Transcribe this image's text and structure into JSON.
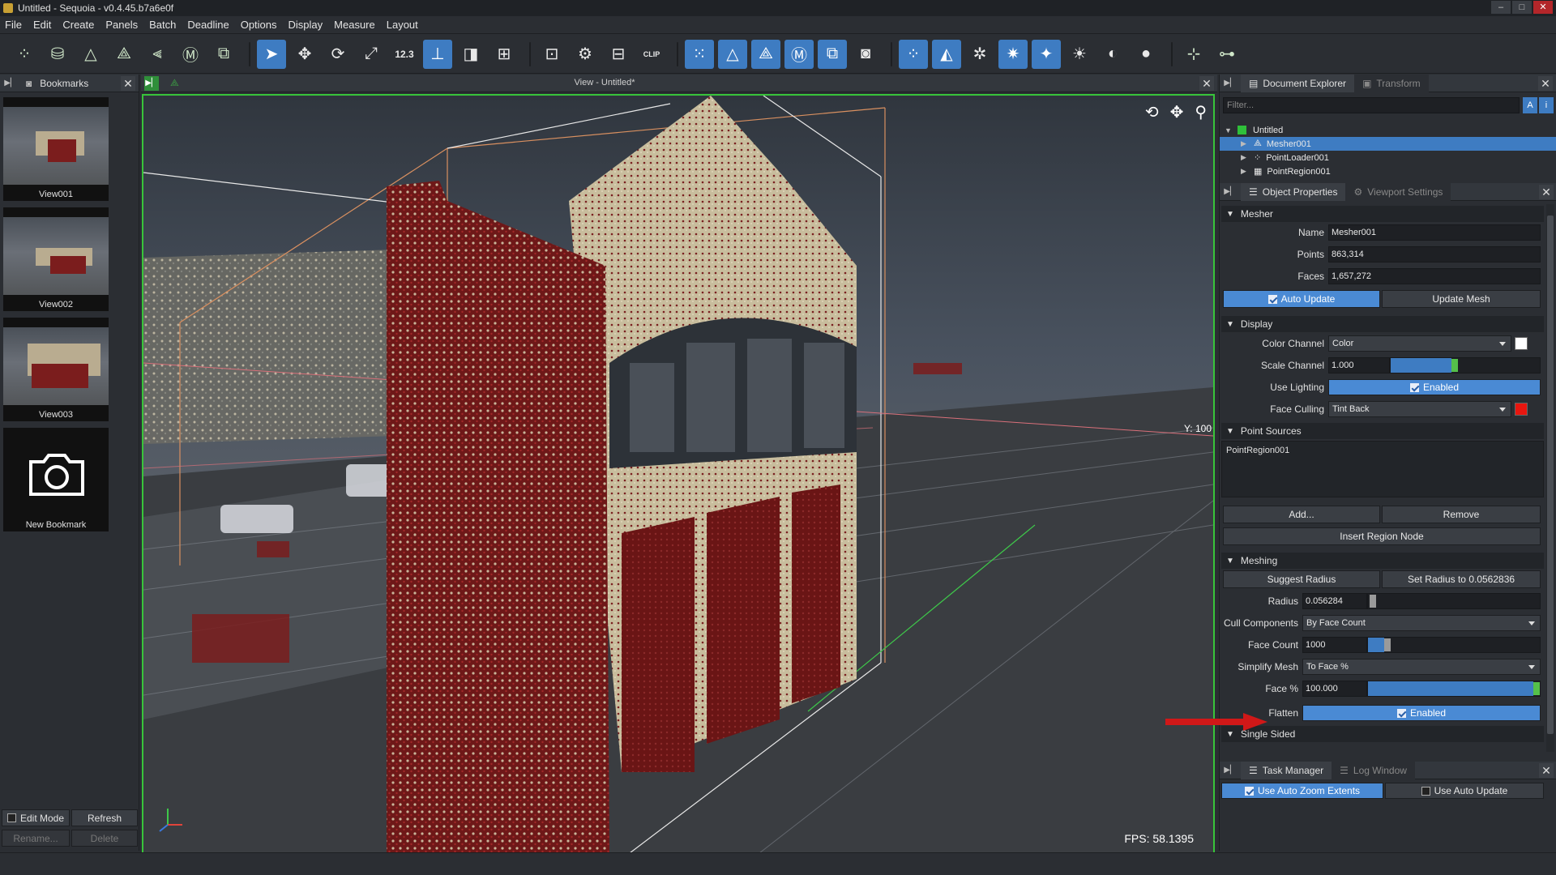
{
  "window": {
    "title": "Untitled - Sequoia - v0.4.45.b7a6e0f"
  },
  "menu": [
    "File",
    "Edit",
    "Create",
    "Panels",
    "Batch",
    "Deadline",
    "Options",
    "Display",
    "Measure",
    "Layout"
  ],
  "toolbar": {
    "numeric_icon": "12.3",
    "clip_icon": "CLIP"
  },
  "bookmarks": {
    "tab": "Bookmarks",
    "items": [
      "View001",
      "View002",
      "View003"
    ],
    "new_label": "New Bookmark",
    "edit_mode": "Edit Mode",
    "refresh": "Refresh",
    "rename": "Rename...",
    "delete": "Delete"
  },
  "viewport": {
    "title": "View - Untitled*",
    "fps": "FPS:  58.1395",
    "axis_label": "Y: 100"
  },
  "document_explorer": {
    "tab": "Document Explorer",
    "tab2": "Transform",
    "filter_placeholder": "Filter...",
    "root": "Untitled",
    "nodes": [
      "Mesher001",
      "PointLoader001",
      "PointRegion001"
    ]
  },
  "properties": {
    "tab": "Object Properties",
    "tab2": "Viewport Settings",
    "mesher": {
      "section": "Mesher",
      "name_label": "Name",
      "name_value": "Mesher001",
      "points_label": "Points",
      "points_value": "863,314",
      "faces_label": "Faces",
      "faces_value": "1,657,272",
      "auto_update": "Auto Update",
      "update_mesh": "Update Mesh"
    },
    "display": {
      "section": "Display",
      "color_channel_label": "Color Channel",
      "color_channel_value": "Color",
      "scale_channel_label": "Scale Channel",
      "scale_channel_value": "1.000",
      "scale_level": 0.5,
      "use_lighting_label": "Use Lighting",
      "use_lighting_value": "Enabled",
      "face_culling_label": "Face Culling",
      "face_culling_value": "Tint Back",
      "face_culling_color": "#e8160f"
    },
    "point_sources": {
      "section": "Point Sources",
      "items": [
        "PointRegion001"
      ],
      "add": "Add...",
      "remove": "Remove",
      "insert_region": "Insert Region Node"
    },
    "meshing": {
      "section": "Meshing",
      "suggest_radius": "Suggest Radius",
      "set_radius": "Set Radius to 0.0562836",
      "radius_label": "Radius",
      "radius_value": "0.056284",
      "cull_label": "Cull Components",
      "cull_value": "By Face Count",
      "face_count_label": "Face Count",
      "face_count_value": "1000",
      "simplify_label": "Simplify Mesh",
      "simplify_value": "To Face %",
      "face_pct_label": "Face %",
      "face_pct_value": "100.000",
      "flatten_label": "Flatten",
      "flatten_value": "Enabled",
      "single_sided": "Single Sided"
    }
  },
  "task_manager": {
    "tab": "Task Manager",
    "tab2": "Log Window",
    "auto_zoom": "Use Auto Zoom Extents",
    "auto_update": "Use Auto Update"
  },
  "colors": {
    "accent": "#3e7cc2",
    "viewport_border": "#38c43a",
    "brick_red": "#7b1d1d"
  }
}
